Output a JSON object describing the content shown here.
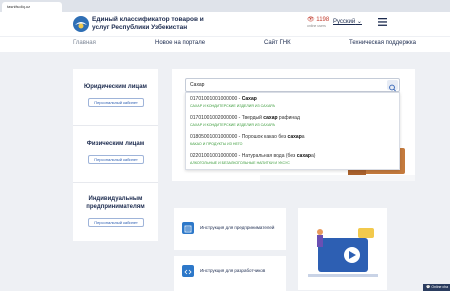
{
  "browser": {
    "tab_title": "tasnifsoliq.uz"
  },
  "header": {
    "title_line1": "Единый классификатор товаров и",
    "title_line2": "услуг Республики Узбекистан",
    "visits_count": "1198",
    "visits_label": "online users",
    "language": "Русский"
  },
  "nav": {
    "items": [
      {
        "label": "Главная"
      },
      {
        "label": "Новое на портале"
      },
      {
        "label": "Сайт ГНК"
      },
      {
        "label": "Техническая поддержка"
      }
    ]
  },
  "left_panel": {
    "sections": [
      {
        "title": "Юридическим лицам",
        "button": "Персональный кабинет"
      },
      {
        "title": "Физическим лицам",
        "button": "Персональный кабинет"
      },
      {
        "title_line1": "Индивидуальным",
        "title_line2": "предпринимателям",
        "button": "Персональный кабинет"
      }
    ]
  },
  "search": {
    "value": "Сахар",
    "results": [
      {
        "code_prefix": "01701001001000000 - ",
        "code_bold": "Сахар",
        "code_suffix": "",
        "category": "САХАР И КОНДИТЕРСКИЕ ИЗДЕЛИЯ ИЗ САХАРА"
      },
      {
        "code_prefix": "01701001002000000 - Твердый ",
        "code_bold": "сахар",
        "code_suffix": " рафинад",
        "category": "САХАР И КОНДИТЕРСКИЕ ИЗДЕЛИЯ ИЗ САХАРА"
      },
      {
        "code_prefix": "01805001001000000 - Порошок какао без ",
        "code_bold": "сахар",
        "code_suffix": "а",
        "category": "КАКАО И ПРОДУКТЫ ИЗ НЕГО"
      },
      {
        "code_prefix": "02201001001000000 - Натуральная вода (без ",
        "code_bold": "сахар",
        "code_suffix": "а)",
        "category": "АЛКОГОЛЬНЫЕ И БЕЗАЛКОГОЛЬНЫЕ НАПИТКИ И УКСУС"
      }
    ]
  },
  "cards": [
    {
      "label": "Инструкция для предпринимателей"
    },
    {
      "label": "Инструкция для разработчиков"
    }
  ],
  "chat": {
    "label": "Online cha"
  },
  "colors": {
    "accent": "#2d5fb3",
    "category": "#3a9b3a",
    "dark": "#1b2a4e"
  }
}
